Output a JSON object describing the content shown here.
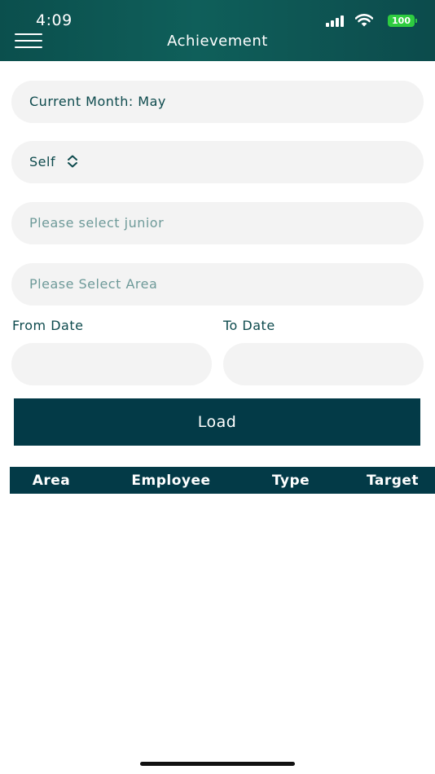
{
  "status_bar": {
    "time": "4:09",
    "battery": "100",
    "icons": [
      "signal-icon",
      "wifi-icon",
      "battery-icon"
    ]
  },
  "header": {
    "title": "Achievement",
    "menu_icon": "hamburger-menu-icon"
  },
  "form": {
    "current_month": "Current Month: May",
    "role_select": "Self",
    "junior_placeholder": "Please select junior",
    "area_placeholder": "Please Select Area",
    "from_date_label": "From Date",
    "to_date_label": "To Date",
    "from_date_value": "",
    "to_date_value": "",
    "load_label": "Load"
  },
  "table": {
    "columns": [
      "Area",
      "Employee",
      "Type",
      "Target"
    ],
    "rows": []
  },
  "colors": {
    "header_bg": "#0f5f5a",
    "primary": "#033a47",
    "field_bg": "#f3f3f3",
    "text_dark": "#0d4a4d",
    "placeholder": "#6e9a99",
    "battery": "#2ecc40"
  }
}
